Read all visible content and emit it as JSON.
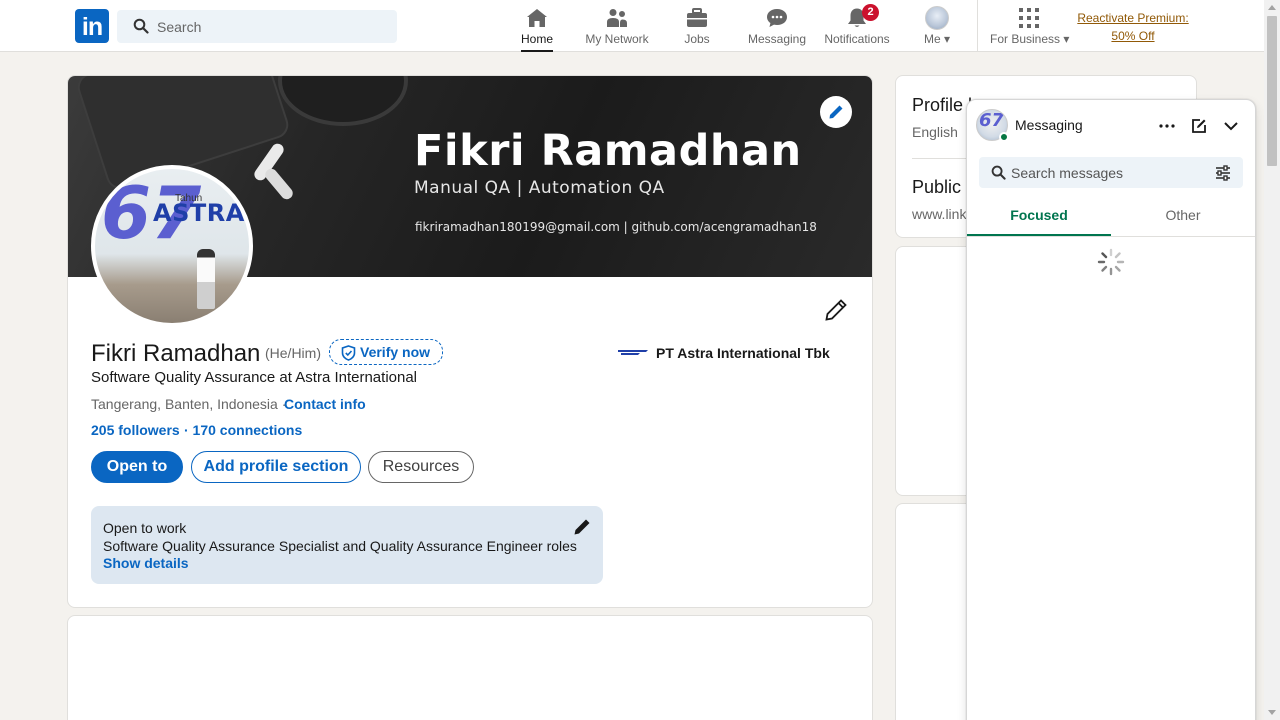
{
  "nav": {
    "logo": "in",
    "search_placeholder": "Search",
    "items": [
      {
        "label": "Home",
        "icon": "home-icon"
      },
      {
        "label": "My Network",
        "icon": "network-icon"
      },
      {
        "label": "Jobs",
        "icon": "briefcase-icon"
      },
      {
        "label": "Messaging",
        "icon": "messaging-icon"
      },
      {
        "label": "Notifications",
        "icon": "bell-icon",
        "badge": "2"
      },
      {
        "label": "Me",
        "icon": "avatar"
      }
    ],
    "for_business": "For Business",
    "premium_line1": "Reactivate Premium:",
    "premium_line2": "50% Off"
  },
  "banner": {
    "name": "Fikri Ramadhan",
    "subtitle": "Manual QA | Automation QA",
    "contact": "fikriramadhan180199@gmail.com | github.com/acengramadhan18"
  },
  "avatar": {
    "number": "67",
    "tahun": "Tahun",
    "brand": "ASTRA"
  },
  "profile": {
    "name": "Fikri Ramadhan",
    "pronouns": "(He/Him)",
    "verify": "Verify now",
    "headline": "Software Quality Assurance at Astra International",
    "location": "Tangerang, Banten, Indonesia ·",
    "contact_info": "Contact info",
    "followers": "205 followers",
    "connections": "· 170 connections",
    "company": "PT Astra International Tbk",
    "buttons": {
      "open_to": "Open to",
      "add_section": "Add profile section",
      "resources": "Resources"
    },
    "open_to_work": {
      "title": "Open to work",
      "roles": "Software Quality Assurance Specialist and Quality Assurance Engineer roles",
      "details": "Show details"
    }
  },
  "sidebar": {
    "profile_language_title": "Profile l",
    "profile_language_value": "English",
    "public_profile_title": "Public",
    "public_profile_url": "www.link"
  },
  "messaging": {
    "title": "Messaging",
    "search_placeholder": "Search messages",
    "tabs": [
      "Focused",
      "Other"
    ]
  },
  "colors": {
    "brand": "#0a66c2",
    "focused_tab": "#01754f",
    "badge": "#cb112d",
    "premium": "#915907"
  }
}
